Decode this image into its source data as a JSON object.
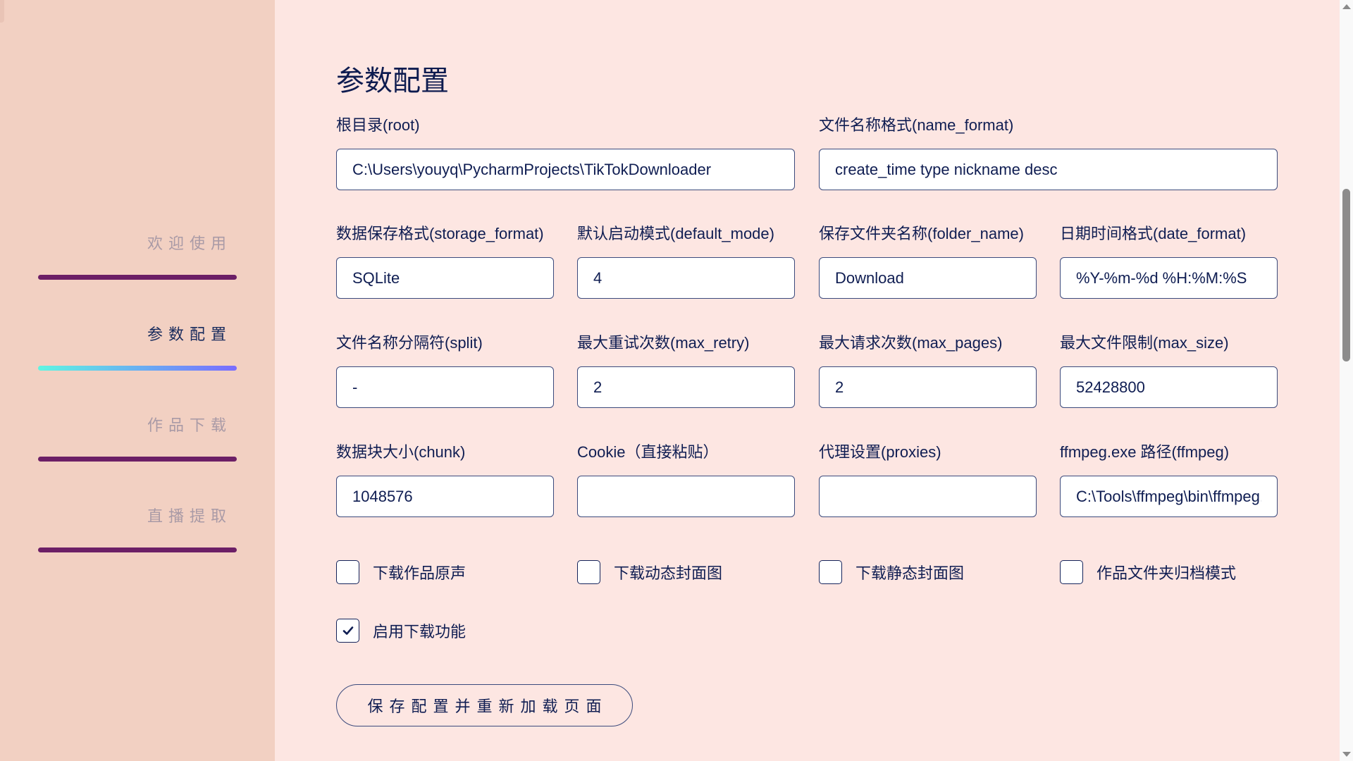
{
  "sidebar": {
    "items": [
      {
        "label": "欢迎使用",
        "active": false
      },
      {
        "label": "参数配置",
        "active": true
      },
      {
        "label": "作品下载",
        "active": false
      },
      {
        "label": "直播提取",
        "active": false
      }
    ],
    "colors": {
      "inactive_bar": "#6c1f66",
      "active_gradient": [
        "#5ff5e2",
        "#7a6cff"
      ]
    }
  },
  "main": {
    "title": "参数配置",
    "fields": {
      "root": {
        "label": "根目录(root)",
        "value": "C:\\Users\\youyq\\PycharmProjects\\TikTokDownloader"
      },
      "name_format": {
        "label": "文件名称格式(name_format)",
        "value": "create_time type nickname desc"
      },
      "storage_format": {
        "label": "数据保存格式(storage_format)",
        "value": "SQLite"
      },
      "default_mode": {
        "label": "默认启动模式(default_mode)",
        "value": "4"
      },
      "folder_name": {
        "label": "保存文件夹名称(folder_name)",
        "value": "Download"
      },
      "date_format": {
        "label": "日期时间格式(date_format)",
        "value": "%Y-%m-%d %H:%M:%S"
      },
      "split": {
        "label": "文件名称分隔符(split)",
        "value": "-"
      },
      "max_retry": {
        "label": "最大重试次数(max_retry)",
        "value": "2"
      },
      "max_pages": {
        "label": "最大请求次数(max_pages)",
        "value": "2"
      },
      "max_size": {
        "label": "最大文件限制(max_size)",
        "value": "52428800"
      },
      "chunk": {
        "label": "数据块大小(chunk)",
        "value": "1048576"
      },
      "cookie": {
        "label": "Cookie（直接粘贴）",
        "value": ""
      },
      "proxies": {
        "label": "代理设置(proxies)",
        "value": ""
      },
      "ffmpeg": {
        "label": "ffmpeg.exe 路径(ffmpeg)",
        "value": "C:\\Tools\\ffmpeg\\bin\\ffmpeg.exe"
      }
    },
    "checkboxes": {
      "music": {
        "label": "下载作品原声",
        "checked": false
      },
      "dynamic_cover": {
        "label": "下载动态封面图",
        "checked": false
      },
      "original_cover": {
        "label": "下载静态封面图",
        "checked": false
      },
      "folder_mode": {
        "label": "作品文件夹归档模式",
        "checked": false
      },
      "download": {
        "label": "启用下载功能",
        "checked": true
      }
    },
    "save_button": "保存配置并重新加载页面"
  }
}
